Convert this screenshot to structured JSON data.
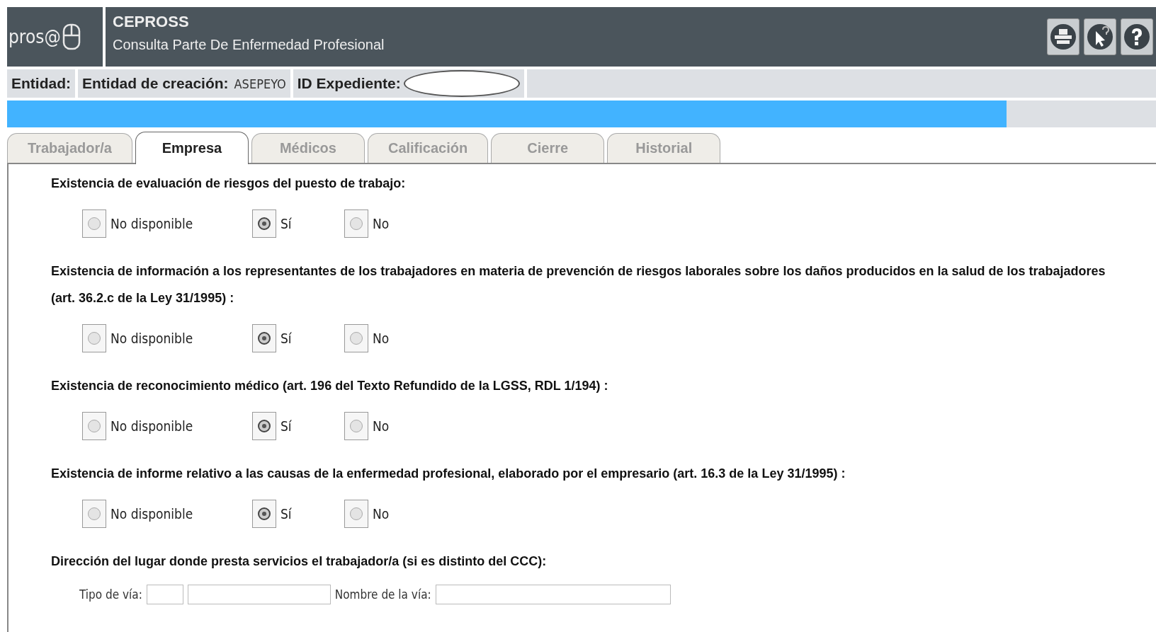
{
  "header": {
    "logo": "pros@",
    "title": "CEPROSS",
    "subtitle": "Consulta Parte De Enfermedad Profesional"
  },
  "toolbar": [
    {
      "kind": "print"
    },
    {
      "kind": "pointer-help"
    },
    {
      "kind": "help"
    }
  ],
  "info_bar": [
    {
      "label": "Entidad:"
    },
    {
      "label": "Entidad de creación:",
      "value": "ASEPEYO"
    },
    {
      "label": "ID Expediente:",
      "redacted": true
    }
  ],
  "progress": {
    "level": 0.87
  },
  "tabs": [
    {
      "label": "Trabajador/a",
      "selected": false
    },
    {
      "label": "Empresa",
      "selected": true
    },
    {
      "label": "Médicos",
      "selected": false
    },
    {
      "label": "Calificación",
      "selected": false
    },
    {
      "label": "Cierre",
      "selected": false
    },
    {
      "label": "Historial",
      "selected": false
    }
  ],
  "questions": [
    {
      "text": "Existencia de evaluación de riesgos del puesto de trabajo:",
      "options": [
        {
          "label": "No disponible",
          "selected": false
        },
        {
          "label": "Sí",
          "selected": true
        },
        {
          "label": "No",
          "selected": false
        }
      ]
    },
    {
      "text": "Existencia de información a los representantes de los trabajadores en materia de prevención de riesgos laborales sobre los daños producidos en la salud de los trabajadores (art. 36.2.c de la Ley 31/1995) :",
      "options": [
        {
          "label": "No disponible",
          "selected": false
        },
        {
          "label": "Sí",
          "selected": true
        },
        {
          "label": "No",
          "selected": false
        }
      ]
    },
    {
      "text": "Existencia de reconocimiento médico (art. 196 del Texto Refundido de la LGSS, RDL 1/194) :",
      "options": [
        {
          "label": "No disponible",
          "selected": false
        },
        {
          "label": "Sí",
          "selected": true
        },
        {
          "label": "No",
          "selected": false
        }
      ]
    },
    {
      "text": "Existencia de informe relativo a las causas de la enfermedad profesional, elaborado por el empresario (art. 16.3 de la Ley 31/1995) :",
      "options": [
        {
          "label": "No disponible",
          "selected": false
        },
        {
          "label": "Sí",
          "selected": true
        },
        {
          "label": "No",
          "selected": false
        }
      ]
    }
  ],
  "address": {
    "heading": "Dirección del lugar donde presta servicios el trabajador/a (si es distinto del CCC):",
    "fields": [
      {
        "label": "Tipo de vía:"
      },
      {
        "label": "Nombre de la vía:"
      }
    ]
  }
}
